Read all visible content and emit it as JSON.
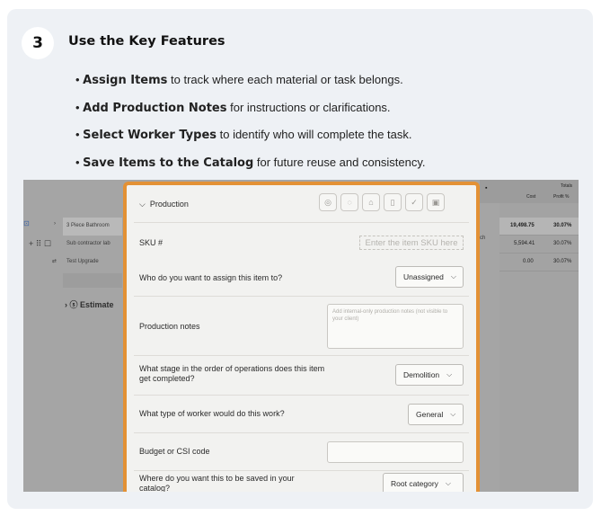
{
  "step": {
    "number": "3",
    "title": "Use the Key Features"
  },
  "bullets": [
    {
      "bold": "Assign Items",
      "rest": " to track where each material or task belongs."
    },
    {
      "bold": "Add Production Notes",
      "rest": " for instructions or clarifications."
    },
    {
      "bold": "Select Worker Types",
      "rest": " to identify who will complete the task."
    },
    {
      "bold": "Save Items to the Catalog",
      "rest": " for future reuse and consistency."
    }
  ],
  "background": {
    "rows": [
      "3 Piece Bathroom",
      "Sub contractor lab",
      "Test Upgrade"
    ],
    "estimate_label": "Estimate",
    "col_headers": {
      "cost": "Cost",
      "profit": "Profit %",
      "totals": "Totals"
    },
    "values": [
      {
        "cost": "19,498.75",
        "profit": "30.07%"
      },
      {
        "cost": "5,594.41",
        "profit": "30.07%"
      },
      {
        "cost": "0.00",
        "profit": "30.07%"
      }
    ],
    "partial_text": "ch"
  },
  "panel": {
    "section_title": "Production",
    "sku_label": "SKU #",
    "sku_placeholder": "Enter the item SKU here",
    "assign_label": "Who do you want to assign this item to?",
    "assign_value": "Unassigned",
    "notes_label": "Production notes",
    "notes_placeholder": "Add internal-only production notes (not visible to your client)",
    "stage_label": "What stage in the order of operations does this item get completed?",
    "stage_value": "Demolition",
    "worker_label": "What type of worker would do this work?",
    "worker_value": "General",
    "budget_label": "Budget or CSI code",
    "catalog_label": "Where do you want this to be saved in your catalog?",
    "catalog_value": "Root category"
  },
  "icons": [
    "user-circle-icon",
    "chat-bubble-icon",
    "home-icon",
    "clipboard-icon",
    "check-circle-icon",
    "image-icon"
  ],
  "colors": {
    "accent": "#e39135",
    "card_bg": "#eef1f5"
  }
}
